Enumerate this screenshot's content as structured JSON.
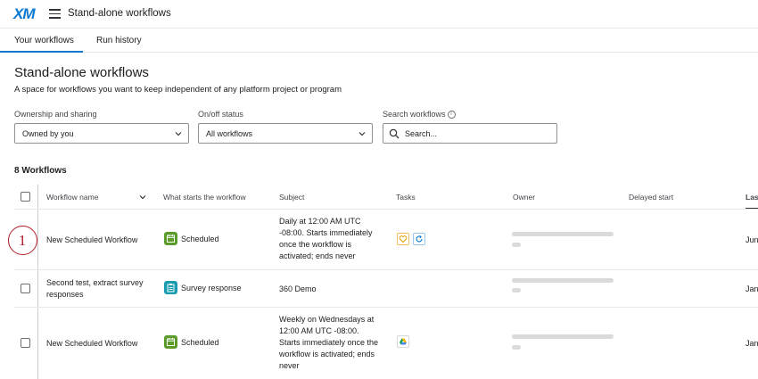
{
  "header": {
    "logo": "XM",
    "title": "Stand-alone workflows"
  },
  "tabs": [
    {
      "label": "Your workflows",
      "active": true
    },
    {
      "label": "Run history",
      "active": false
    }
  ],
  "page": {
    "title": "Stand-alone workflows",
    "subtitle": "A space for workflows you want to keep independent of any platform project or program"
  },
  "filters": {
    "ownership": {
      "label": "Ownership and sharing",
      "value": "Owned by you"
    },
    "status": {
      "label": "On/off status",
      "value": "All workflows"
    },
    "search": {
      "label": "Search workflows",
      "placeholder": "Search..."
    }
  },
  "workflow_count": "8 Workflows",
  "table": {
    "headers": {
      "name": "Workflow name",
      "trigger": "What starts the workflow",
      "subject": "Subject",
      "tasks": "Tasks",
      "owner": "Owner",
      "delayed": "Delayed start",
      "last": "Last"
    },
    "rows": [
      {
        "name": "New Scheduled Workflow",
        "trigger": "Scheduled",
        "subject": [
          "Daily at 12:00 AM UTC",
          "-08:00. Starts immediately",
          "once the workflow is",
          "activated; ends never"
        ],
        "tasks": [
          "heart-icon",
          "refresh-icon"
        ],
        "last": "Jun"
      },
      {
        "name": [
          "Second test, extract survey",
          "responses"
        ],
        "trigger": "Survey response",
        "subject": [
          "360 Demo"
        ],
        "tasks": [],
        "last": "Jan"
      },
      {
        "name": "New Scheduled Workflow",
        "trigger": "Scheduled",
        "subject": [
          "Weekly on Wednesdays at",
          "12:00 AM UTC -08:00.",
          "Starts immediately once the",
          "workflow is activated; ends",
          "never"
        ],
        "tasks": [
          "google-drive-icon"
        ],
        "last": "Jan"
      }
    ]
  },
  "callout": "1",
  "colors": {
    "accent": "#0b78d1",
    "scheduled_icon": "#5b9b2a",
    "survey_icon": "#1a9cb0",
    "callout": "#b11c2b"
  }
}
